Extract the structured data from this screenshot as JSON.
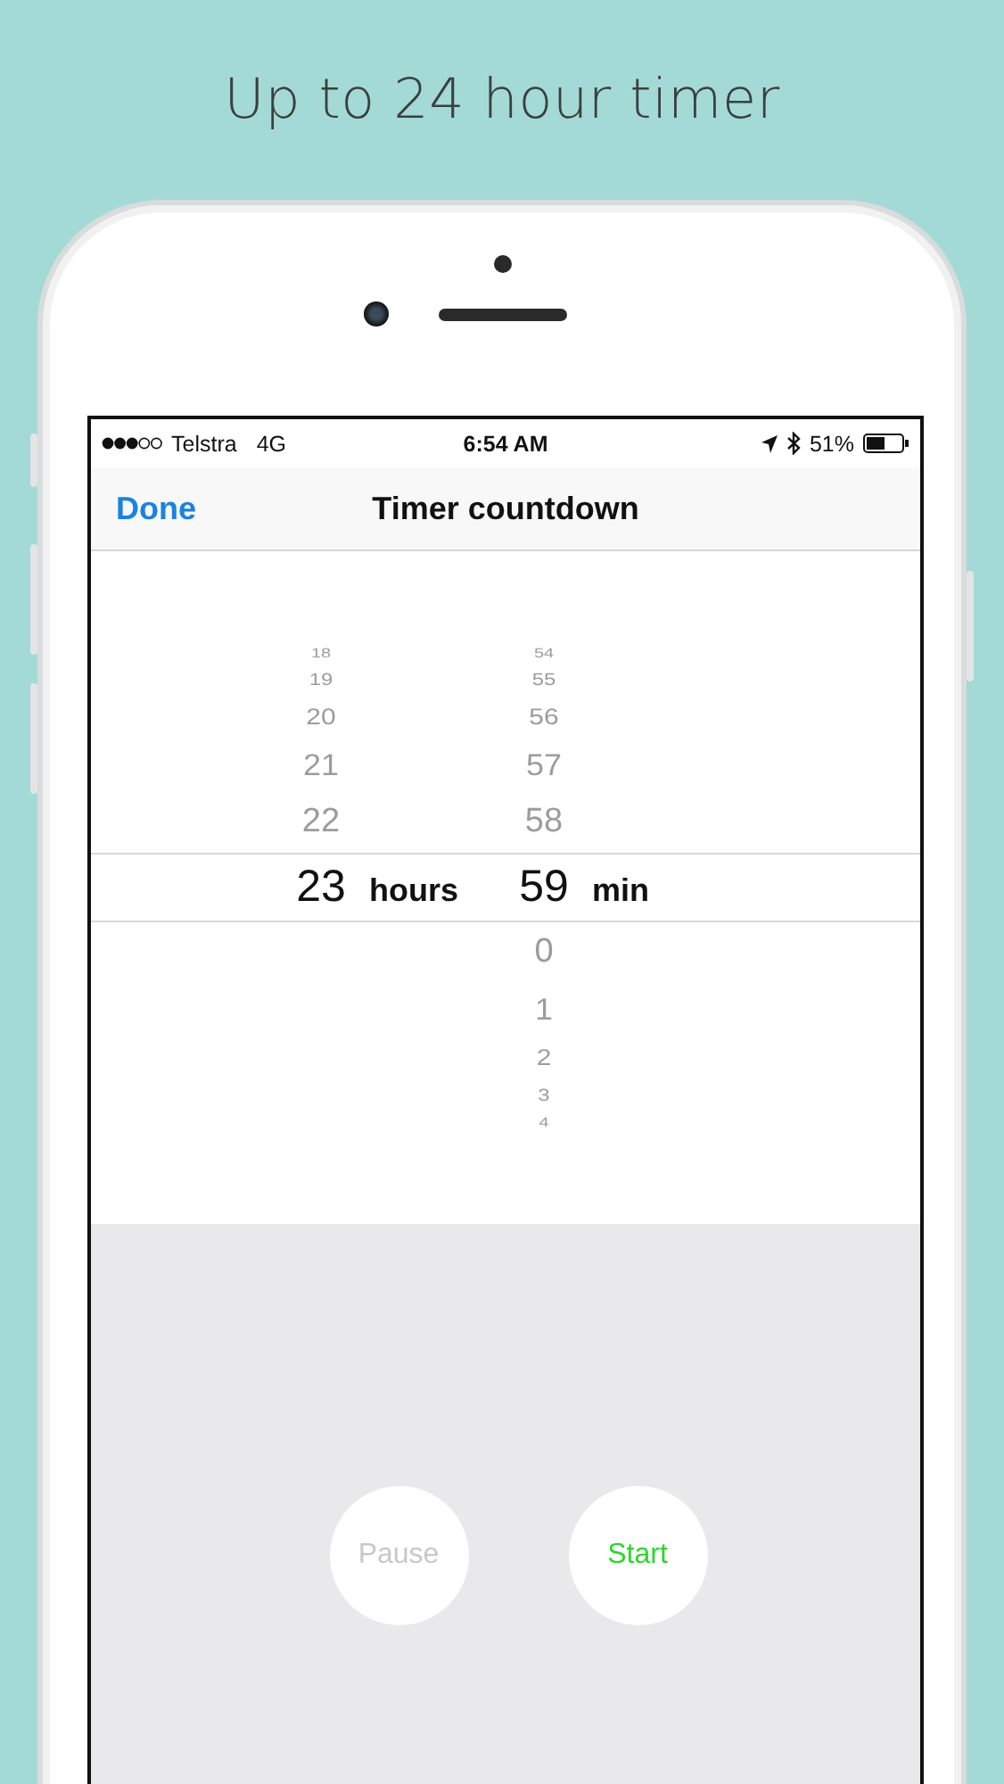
{
  "headline": "Up to 24 hour timer",
  "status_bar": {
    "carrier": "Telstra",
    "network": "4G",
    "time": "6:54 AM",
    "battery": "51%"
  },
  "nav": {
    "left_button": "Done",
    "title": "Timer countdown"
  },
  "picker": {
    "columns": [
      {
        "above": [
          "18",
          "19",
          "20",
          "21",
          "22"
        ],
        "value": "23",
        "unit": "hours"
      },
      {
        "above": [
          "54",
          "55",
          "56",
          "57",
          "58"
        ],
        "value": "59",
        "unit": "min",
        "below": [
          "0",
          "1",
          "2",
          "3",
          "4"
        ]
      }
    ]
  },
  "buttons": [
    {
      "label": "Pause",
      "disabled": true
    },
    {
      "label": "Start",
      "disabled": false
    }
  ]
}
